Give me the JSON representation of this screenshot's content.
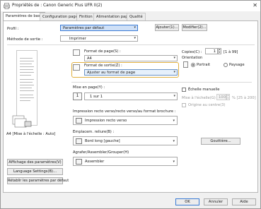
{
  "window": {
    "title": "Propriétés de : Canon Generic Plus UFR II(2)",
    "close": "✕"
  },
  "tabs": [
    "Paramètres de base",
    "Configuration page",
    "Finition",
    "Alimentation papier",
    "Qualité"
  ],
  "profile": {
    "label": "Profil :",
    "value": "Paramètres par défaut",
    "add": "Ajouter(1)...",
    "modify": "Modifier(2)..."
  },
  "output": {
    "label": "Méthode de sortie :",
    "value": "Imprimer"
  },
  "preview": {
    "caption": "A4 [Mise à l'échelle : Auto]",
    "display_settings": "Affichage des paramètres(V)",
    "language": "Language Settings(B)...",
    "restore": "Rétablir les paramètres par défaut"
  },
  "page_format": {
    "label": "Format de page(S) :",
    "value": "A4"
  },
  "output_format": {
    "label": "Format de sortie(Z) :",
    "value": "Ajuster au format de page"
  },
  "copies": {
    "label": "Copies(C) :",
    "value": "1",
    "range": "[1 à 99]"
  },
  "orientation": {
    "label": "Orientation",
    "portrait": "Portrait",
    "landscape": "Paysage"
  },
  "layout": {
    "label": "Mise en page(Y) :",
    "value": "1 sur 1"
  },
  "scale": {
    "manual": "Échelle manuelle",
    "label": "Mise à l'échelle(G) :",
    "value": "100",
    "range": "% [25 à 200]",
    "origin": "Origine au centre(3)"
  },
  "duplex": {
    "label": "Impression recto verso/recto verso/au format brochure :",
    "value": "Impression recto verso"
  },
  "binding": {
    "label": "Emplacem. reliure(B) :",
    "value": "Bord long [gauche]",
    "gutter": "Gouttière..."
  },
  "staple": {
    "label": "Agrafer/Assembler/Grouper(H)",
    "value": "Assembler"
  },
  "footer": {
    "ok": "OK",
    "cancel": "Annuler",
    "help": "Aide"
  },
  "colors": {
    "accent": "#e0b040",
    "focus": "#3a7bd5"
  }
}
